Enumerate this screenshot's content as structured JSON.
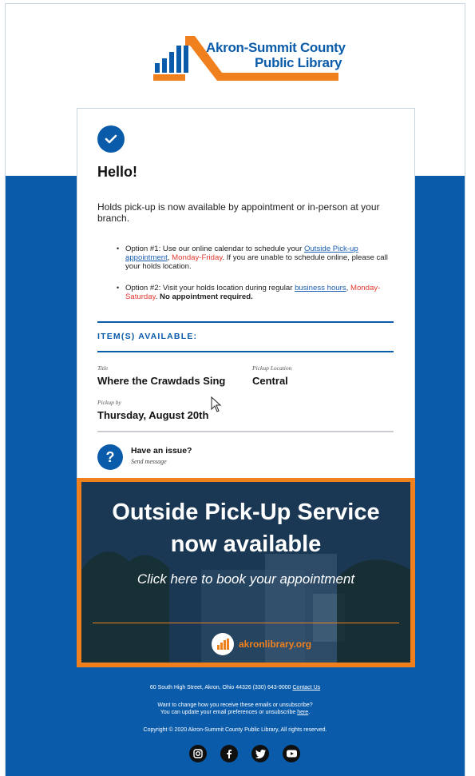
{
  "header": {
    "logo_line1": "Akron-Summit County",
    "logo_line2": "Public Library"
  },
  "card": {
    "greeting": "Hello!",
    "intro": "Holds pick-up is now available by appointment or in-person at your branch.",
    "option1": {
      "prefix": "Option #1: Use our online calendar to schedule your ",
      "link": "Outside Pick-up appointment",
      "sep": ", ",
      "days": "Monday-Friday",
      "suffix": ". If you are unable to schedule online, please call your holds location."
    },
    "option2": {
      "prefix": "Option #2: Visit your holds location during regular ",
      "link": "business hours",
      "sep": ", ",
      "days": "Monday-Saturday",
      "mid": ". ",
      "bold": "No appointment required."
    },
    "items_heading": "ITEM(S) AVAILABLE:",
    "item": {
      "title_label": "Title",
      "title": "Where the Crawdads Sing",
      "pickup_location_label": "Pickup Location",
      "pickup_location": "Central",
      "pickup_by_label": "Pickup by",
      "pickup_by": "Thursday, August 20th"
    },
    "issue": {
      "title": "Have an issue?",
      "subtitle": "Send message",
      "icon_glyph": "?"
    }
  },
  "banner": {
    "title_line1": "Outside Pick-Up Service",
    "title_line2": "now available",
    "subtitle": "Click here to book your appointment",
    "url": "akronlibrary.org"
  },
  "footer": {
    "address": "60 South High Street, Akron, Ohio 44326 (330) 643-9000 ",
    "contact_link": "Contact Us",
    "pref_line1": "Want to change how you receive these emails or unsubscribe?",
    "pref_line2_prefix": "You can update your email preferences or unsubscribe ",
    "pref_link": "here",
    "pref_line2_suffix": ".",
    "copyright": "Copyright © 2020 Akron-Summit County Public Library, All rights reserved."
  },
  "social": [
    "instagram-icon",
    "facebook-icon",
    "twitter-icon",
    "youtube-icon"
  ],
  "colors": {
    "brand_blue": "#0a5cab",
    "brand_orange": "#f0801e",
    "alert_red": "#e03a2f"
  }
}
